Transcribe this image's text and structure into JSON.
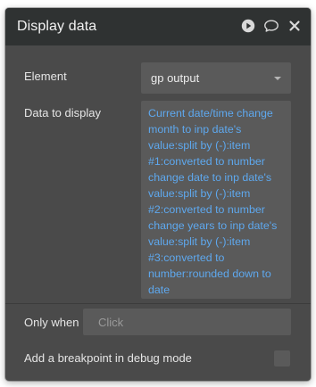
{
  "window": {
    "title": "Display data",
    "icons": [
      "play-icon",
      "comment-icon",
      "close-icon"
    ]
  },
  "fields": {
    "element": {
      "label": "Element",
      "value": "gp output"
    },
    "data_to_display": {
      "label": "Data to display",
      "expression_lines": [
        "Current date/time change",
        "month to inp date's",
        "value:split by (-):item",
        "#1:converted to number",
        "change date to inp date's",
        "value:split by (-):item",
        "#2:converted to number",
        "change years to inp date's",
        "value:split by (-):item",
        "#3:converted to",
        "number:rounded down to",
        "date"
      ]
    },
    "only_when": {
      "label": "Only when",
      "placeholder": "Click"
    },
    "breakpoint": {
      "label": "Add a breakpoint in debug mode",
      "checked": false
    }
  },
  "colors": {
    "panel_bg": "#4a4a4a",
    "titlebar_bg": "#2f3232",
    "field_bg": "#5a5a5a",
    "expression_text": "#5ea8ee"
  }
}
